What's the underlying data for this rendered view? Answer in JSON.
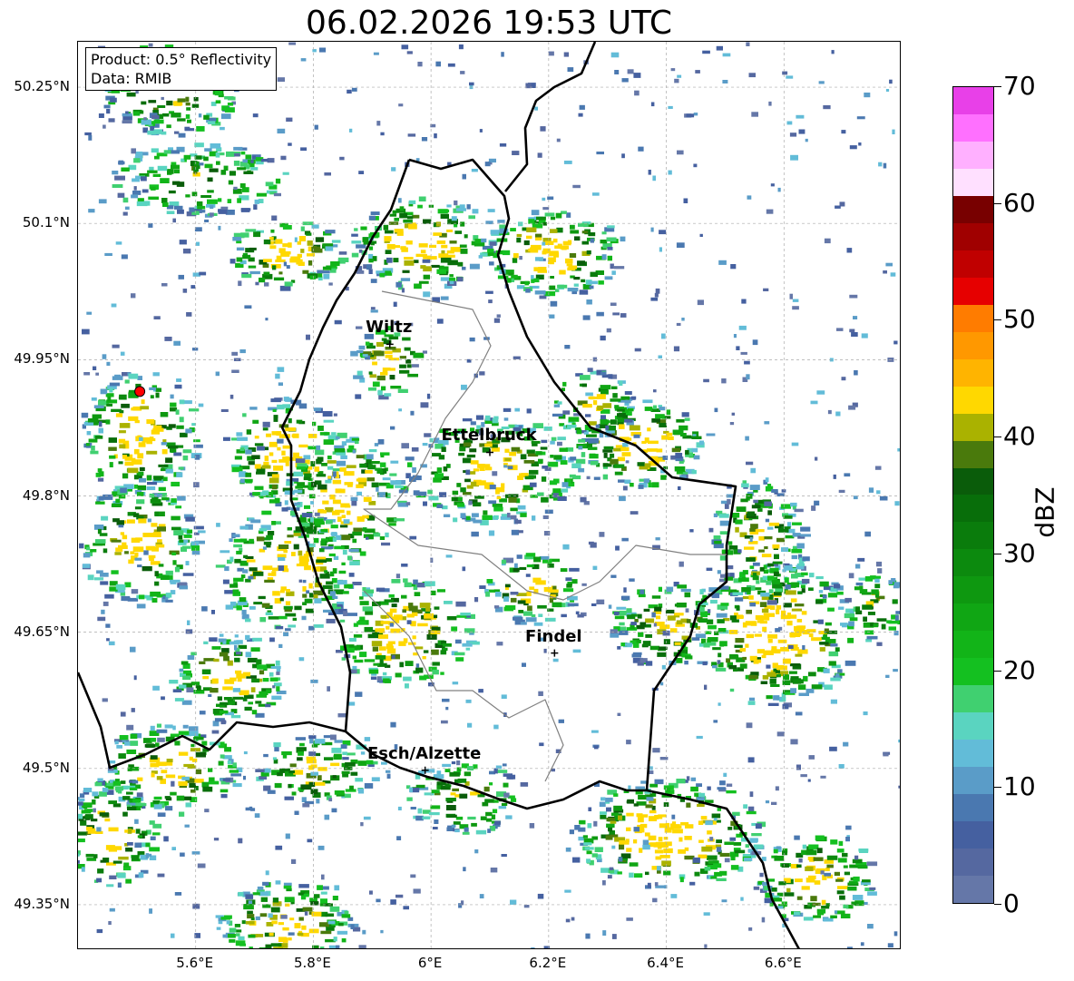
{
  "title": "06.02.2026 19:53 UTC",
  "info": {
    "product": "Product: 0.5° Reflectivity",
    "source": "Data: RMIB"
  },
  "axes": {
    "lat_labels": [
      "50.25°N",
      "50.1°N",
      "49.95°N",
      "49.8°N",
      "49.65°N",
      "49.5°N",
      "49.35°N"
    ],
    "lat_values": [
      50.25,
      50.1,
      49.95,
      49.8,
      49.65,
      49.5,
      49.35
    ],
    "lon_labels": [
      "5.6°E",
      "5.8°E",
      "6°E",
      "6.2°E",
      "6.4°E",
      "6.6°E"
    ],
    "lon_values": [
      5.6,
      5.8,
      6.0,
      6.2,
      6.4,
      6.6
    ],
    "lon_range": [
      5.4,
      6.8
    ],
    "lat_range": [
      49.3,
      50.3
    ],
    "grid": true
  },
  "cities": [
    {
      "name": "Wiltz",
      "lon": 5.93,
      "lat": 49.967
    },
    {
      "name": "Ettelbruck",
      "lon": 6.1,
      "lat": 49.848
    },
    {
      "name": "Findel",
      "lon": 6.21,
      "lat": 49.627
    },
    {
      "name": "Esch/Alzette",
      "lon": 5.99,
      "lat": 49.498
    }
  ],
  "radar_site": {
    "lon": 5.505,
    "lat": 49.915,
    "color": "#ff0000"
  },
  "colorbar": {
    "label": "dBZ",
    "min": 0,
    "max": 70,
    "ticks": [
      "0",
      "10",
      "20",
      "30",
      "40",
      "50",
      "60",
      "70"
    ],
    "colors": [
      "#6577a8",
      "#5568a0",
      "#4560a0",
      "#4a78b0",
      "#5a9cc8",
      "#62bcd8",
      "#5ad4c0",
      "#40d070",
      "#14c020",
      "#12b418",
      "#10a614",
      "#0e9810",
      "#0c8a0e",
      "#0a7c0c",
      "#086e0a",
      "#0a5c0a",
      "#4a7a0c",
      "#aab200",
      "#ffd800",
      "#ffb400",
      "#ff9800",
      "#ff7c00",
      "#e60000",
      "#c00000",
      "#a00000",
      "#780000",
      "#ffe0ff",
      "#ffb0ff",
      "#ff70ff",
      "#e840e8"
    ]
  },
  "borders_color": "#000000",
  "cantons_color": "#808080"
}
